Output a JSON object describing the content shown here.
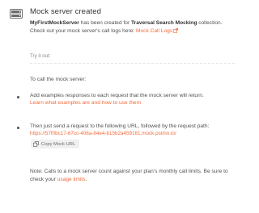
{
  "header": {
    "title": "Mock server created",
    "server_name": "MyFirstMockServer",
    "created_text": " has been created for ",
    "collection_name": "Traversal Search Mocking",
    "collection_suffix": " collection.",
    "logs_prefix": "Check out your mock server's call logs here: ",
    "logs_link": "Mock Call Logs"
  },
  "try_out": {
    "label": "Try it out:",
    "intro": "To call the mock server:"
  },
  "steps": [
    {
      "text": "Add examples responses to each request that the mock server will return.",
      "link": "Learn what examples are and how to use them"
    },
    {
      "text": "Then just send a request to the following URL, followed by the request path:",
      "url": "https://57f0bc17-67cc-408a-84e4-b15b2a459161.mock.pstmn.io/",
      "copy_label": "Copy Mock URL"
    }
  ],
  "note": {
    "text": "Note: Calls to a mock server count against your plan's monthly call limits. Be sure to check your ",
    "link": "usage limits",
    "suffix": "."
  },
  "colors": {
    "accent": "#f26b3a",
    "text": "#505050",
    "icon": "#6b6b6b"
  },
  "icons": [
    "server-icon",
    "external-link-icon",
    "copy-icon"
  ]
}
